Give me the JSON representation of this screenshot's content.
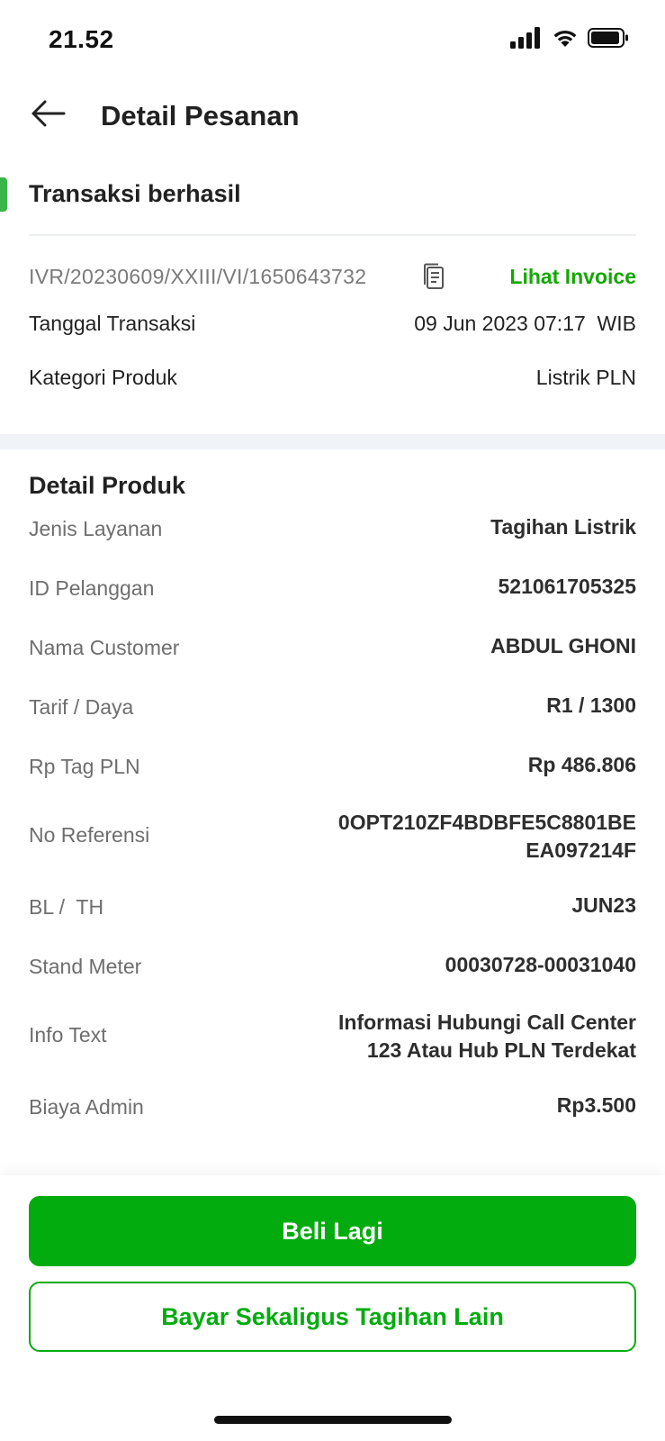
{
  "status_bar": {
    "time": "21.52",
    "icons": [
      "signal-icon",
      "wifi-icon",
      "battery-icon"
    ]
  },
  "header": {
    "back_icon": "arrow-left-icon",
    "title": "Detail Pesanan"
  },
  "transaction": {
    "status": "Transaksi berhasil",
    "invoice_code": "IVR/20230609/XXIII/VI/1650643732",
    "copy_icon": "copy-icon",
    "invoice_link": "Lihat Invoice",
    "date_label": "Tanggal Transaksi",
    "date_value": "09 Jun 2023 07:17  WIB",
    "category_label": "Kategori Produk",
    "category_value": "Listrik PLN"
  },
  "detail": {
    "title": "Detail Produk",
    "rows": [
      {
        "label": "Jenis Layanan",
        "value": "Tagihan Listrik"
      },
      {
        "label": "ID Pelanggan",
        "value": "521061705325"
      },
      {
        "label": "Nama Customer",
        "value": "ABDUL GHONI"
      },
      {
        "label": "Tarif / Daya",
        "value": "R1 / 1300"
      },
      {
        "label": "Rp Tag PLN",
        "value": "Rp 486.806"
      },
      {
        "label": "No Referensi",
        "value_line1": "0OPT210ZF4BDBFE5C8801BE",
        "value_line2": "EA097214F"
      },
      {
        "label": "BL /  TH",
        "value": "JUN23"
      },
      {
        "label": "Stand Meter",
        "value": "00030728-00031040"
      },
      {
        "label": "Info Text",
        "value_line1": "Informasi Hubungi Call Center",
        "value_line2": "123 Atau Hub PLN Terdekat"
      },
      {
        "label": "Biaya Admin",
        "value": "Rp3.500"
      }
    ]
  },
  "actions": {
    "primary": "Beli Lagi",
    "secondary": "Bayar Sekaligus Tagihan Lain"
  },
  "colors": {
    "accent_green": "#03ac0e",
    "link_green": "#12a800",
    "status_indicator": "#39b54a"
  }
}
